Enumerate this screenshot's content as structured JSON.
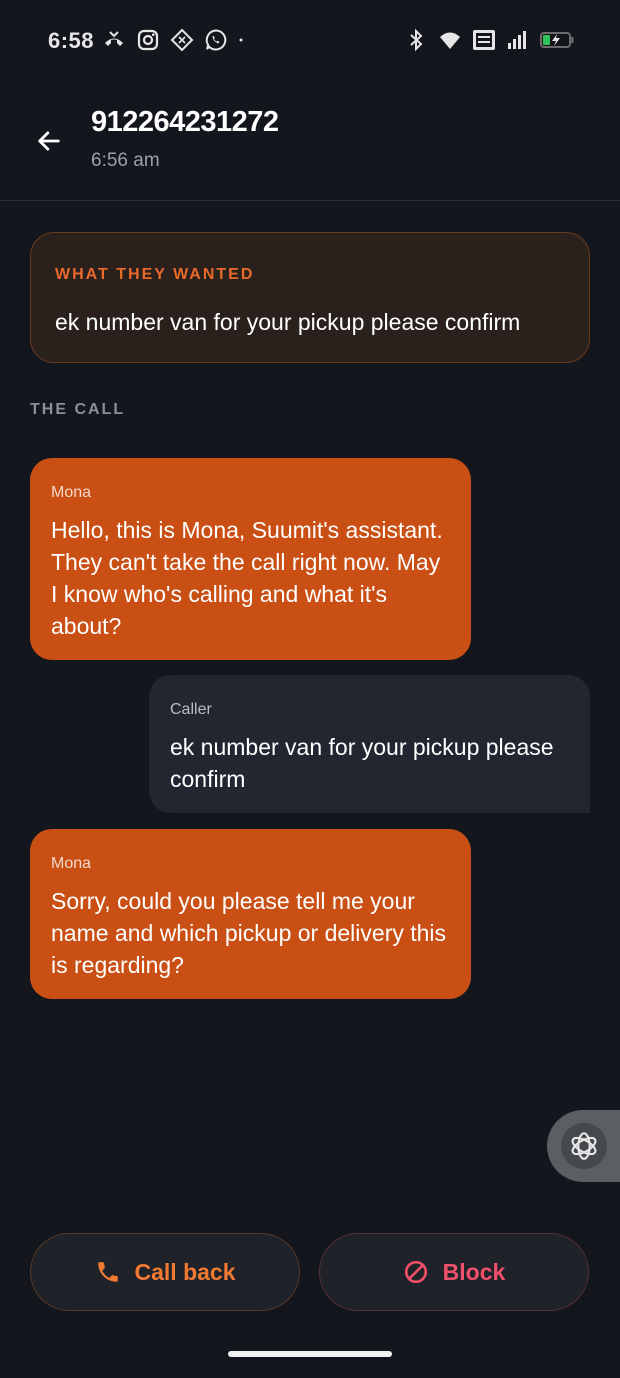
{
  "status_bar": {
    "time": "6:58",
    "left_icons": [
      "missed-call-icon",
      "instagram-icon",
      "app-icon",
      "whatsapp-icon",
      "dot-icon"
    ],
    "right_icons": [
      "bluetooth-icon",
      "wifi-icon",
      "volte-icon",
      "signal-icon",
      "battery-charging-icon"
    ]
  },
  "header": {
    "title": "912264231272",
    "subtitle": "6:56 am"
  },
  "summary": {
    "label": "WHAT THEY WANTED",
    "text": "ek number van for your pickup please confirm"
  },
  "section_label": "THE CALL",
  "messages": [
    {
      "speaker": "Mona",
      "text": "Hello, this is Mona, Suumit's assistant. They can't take the call right now. May I know who's calling and what it's about?"
    },
    {
      "speaker": "Caller",
      "text": "ek number van for your pickup please confirm"
    },
    {
      "speaker": "Mona",
      "text": "Sorry, could you please tell me your name and which pickup or delivery this is regarding?"
    }
  ],
  "actions": {
    "call_back": "Call back",
    "block": "Block"
  },
  "colors": {
    "background": "#13161d",
    "accent": "#c94f14",
    "callback": "#f07a32",
    "block": "#f0506a"
  }
}
